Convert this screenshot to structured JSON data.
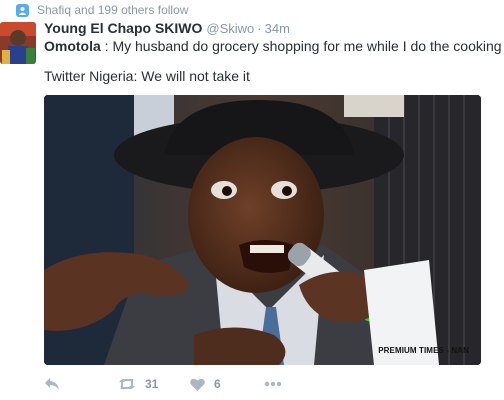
{
  "context": {
    "text": "Shafiq and 199 others follow",
    "icon": "follow-icon"
  },
  "author": {
    "fullname": "Young El Chapo SKIWO",
    "username": "@Skiwo",
    "separator": "·",
    "time": "34m"
  },
  "tweet": {
    "line1_bold": "Omotola",
    "line1_rest": " : My husband do  grocery shopping for me while I do the cooking",
    "line1_emoji": "smiling-face-emoji",
    "line2": "Twitter Nigeria: We will not take it"
  },
  "media": {
    "watermark": "PREMIUM TIMES -  NAN"
  },
  "actions": {
    "reply_icon": "reply-icon",
    "retweet_icon": "retweet-icon",
    "retweet_count": "31",
    "like_icon": "heart-icon",
    "like_count": "6",
    "more_icon": "more-dots-icon"
  },
  "colors": {
    "accent": "#55acee",
    "muted": "#8899a6",
    "icon": "#aab8c2",
    "text": "#292f33"
  }
}
